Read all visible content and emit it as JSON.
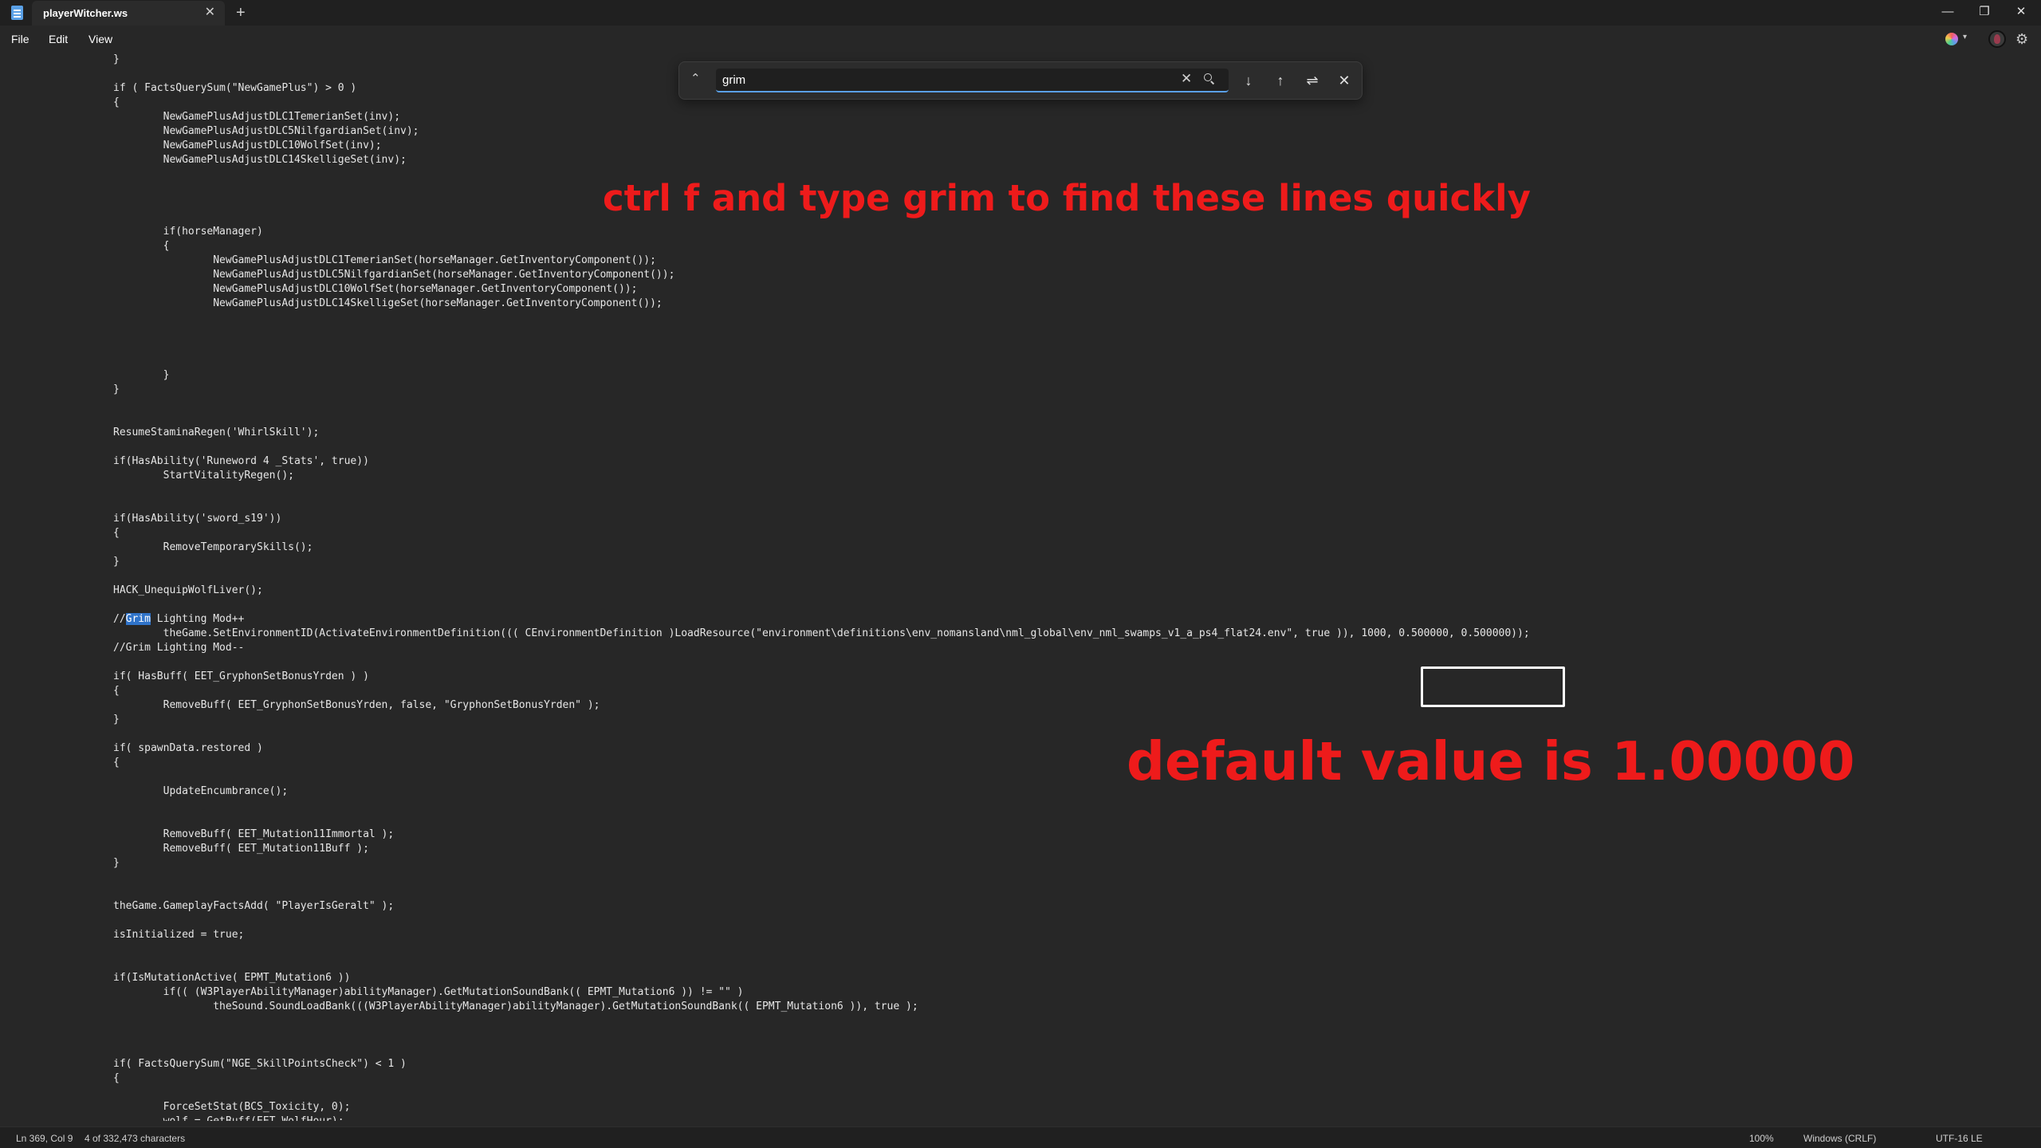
{
  "window": {
    "tab_title": "playerWitcher.ws",
    "tab_close": "✕",
    "new_tab": "+",
    "minimize": "—",
    "maximize": "❐",
    "close": "✕"
  },
  "menu": {
    "file": "File",
    "edit": "Edit",
    "view": "View"
  },
  "find": {
    "query": "grim",
    "toggle": "⌃",
    "clear": "✕",
    "next": "↓",
    "previous": "↑",
    "options": "⇌",
    "close": "✕"
  },
  "code_lines": [
    "}",
    "",
    "if ( FactsQuerySum(\"NewGamePlus\") > 0 )",
    "{",
    "        NewGamePlusAdjustDLC1TemerianSet(inv);",
    "        NewGamePlusAdjustDLC5NilfgardianSet(inv);",
    "        NewGamePlusAdjustDLC10WolfSet(inv);",
    "        NewGamePlusAdjustDLC14SkelligeSet(inv);",
    "",
    "",
    "",
    "",
    "        if(horseManager)",
    "        {",
    "                NewGamePlusAdjustDLC1TemerianSet(horseManager.GetInventoryComponent());",
    "                NewGamePlusAdjustDLC5NilfgardianSet(horseManager.GetInventoryComponent());",
    "                NewGamePlusAdjustDLC10WolfSet(horseManager.GetInventoryComponent());",
    "                NewGamePlusAdjustDLC14SkelligeSet(horseManager.GetInventoryComponent());",
    "",
    "",
    "",
    "",
    "        }",
    "}",
    "",
    "",
    "ResumeStaminaRegen('WhirlSkill');",
    "",
    "if(HasAbility('Runeword 4 _Stats', true))",
    "        StartVitalityRegen();",
    "",
    "",
    "if(HasAbility('sword_s19'))",
    "{",
    "        RemoveTemporarySkills();",
    "}",
    "",
    "HACK_UnequipWolfLiver();",
    "",
    "//Grim Lighting Mod++",
    "        theGame.SetEnvironmentID(ActivateEnvironmentDefinition((( CEnvironmentDefinition )LoadResource(\"environment\\definitions\\env_nomansland\\nml_global\\env_nml_swamps_v1_a_ps4_flat24.env\", true )), 1000, 0.500000, 0.500000));",
    "//Grim Lighting Mod--",
    "",
    "if( HasBuff( EET_GryphonSetBonusYrden ) )",
    "{",
    "        RemoveBuff( EET_GryphonSetBonusYrden, false, \"GryphonSetBonusYrden\" );",
    "}",
    "",
    "if( spawnData.restored )",
    "{",
    "",
    "        UpdateEncumbrance();",
    "",
    "",
    "        RemoveBuff( EET_Mutation11Immortal );",
    "        RemoveBuff( EET_Mutation11Buff );",
    "}",
    "",
    "",
    "theGame.GameplayFactsAdd( \"PlayerIsGeralt\" );",
    "",
    "isInitialized = true;",
    "",
    "",
    "if(IsMutationActive( EPMT_Mutation6 ))",
    "        if(( (W3PlayerAbilityManager)abilityManager).GetMutationSoundBank(( EPMT_Mutation6 )) != \"\" )",
    "                theSound.SoundLoadBank(((W3PlayerAbilityManager)abilityManager).GetMutationSoundBank(( EPMT_Mutation6 )), true );",
    "",
    "",
    "",
    "if( FactsQuerySum(\"NGE_SkillPointsCheck\") < 1 )",
    "{",
    "",
    "        ForceSetStat(BCS_Toxicity, 0);",
    "        wolf = GetBuff(EET_WolfHour);"
  ],
  "match": {
    "line_index": 39,
    "prefix": "//",
    "text": "Grim",
    "suffix": " Lighting Mod++"
  },
  "annotations": {
    "top": "ctrl f and type grim to find these lines quickly",
    "default_value": "default value is 1.00000",
    "color": "#ee1b1b"
  },
  "status": {
    "position": "Ln 369, Col 9",
    "count": "4 of 332,473 characters",
    "zoom": "100%",
    "line_ending": "Windows (CRLF)",
    "encoding": "UTF-16 LE"
  },
  "colors": {
    "background": "#272727",
    "chrome": "#202020",
    "accent": "#5aa0e6",
    "selection": "#2f73c9"
  }
}
